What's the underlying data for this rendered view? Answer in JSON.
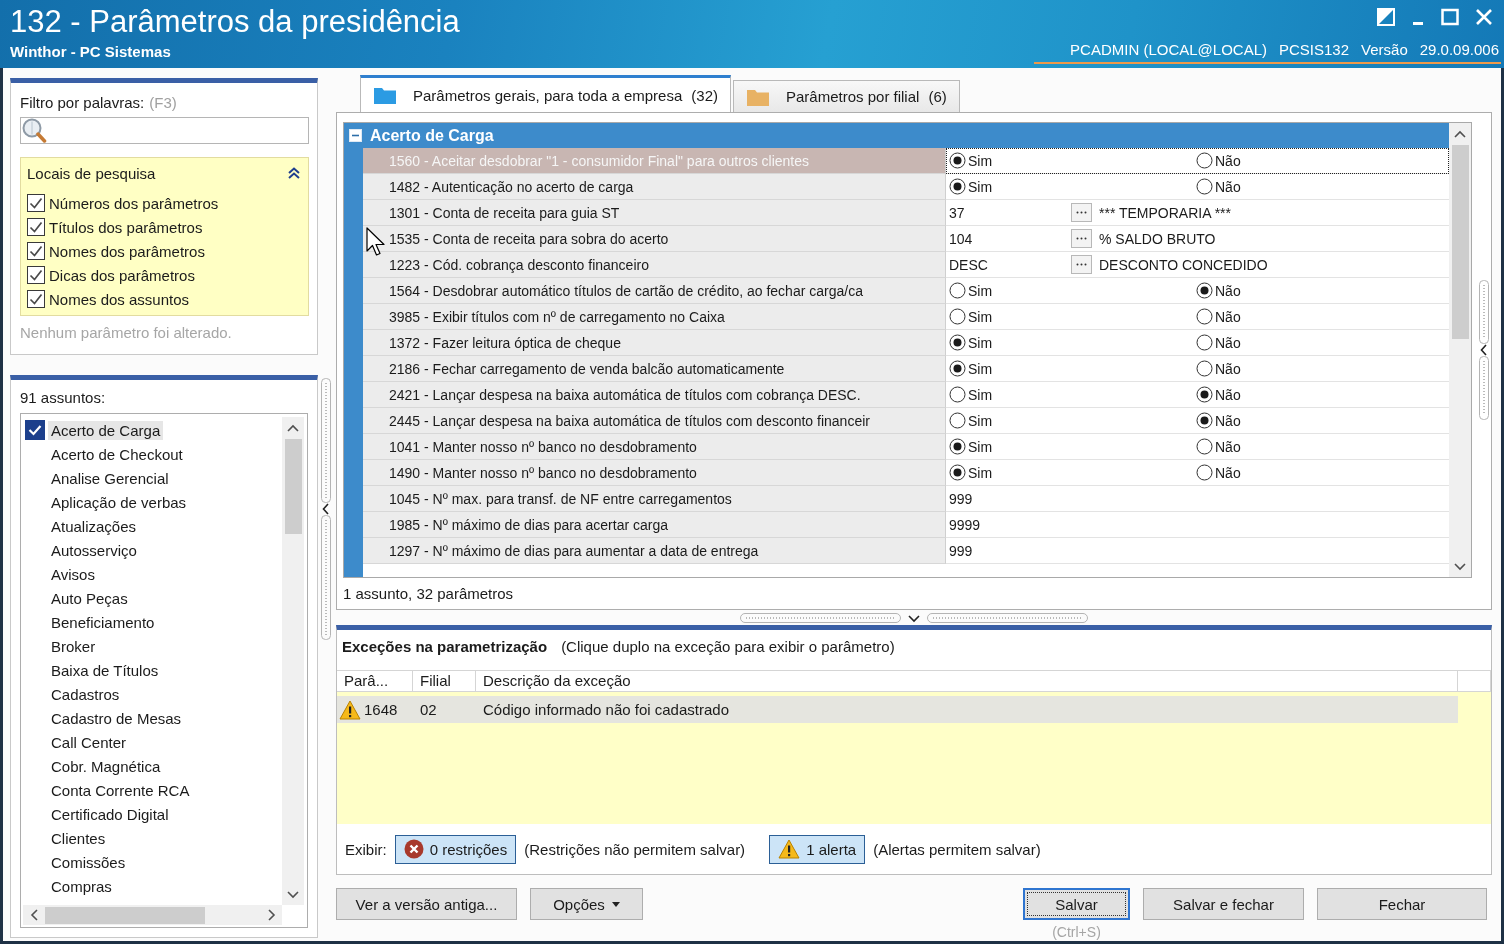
{
  "window": {
    "title": "132 - Parâmetros da presidência",
    "subtitle": "Winthor - PC Sistemas",
    "session": [
      "PCADMIN (LOCAL@LOCAL)",
      "PCSIS132",
      "Versão",
      "29.0.09.006"
    ]
  },
  "filter": {
    "label": "Filtro por palavras:",
    "shortcut": "(F3)",
    "search_places": {
      "title": "Locais de pesquisa",
      "expanded": true,
      "options": [
        {
          "label": "Números dos parâmetros",
          "checked": true
        },
        {
          "label": "Títulos dos parâmetros",
          "checked": true
        },
        {
          "label": "Nomes dos parâmetros",
          "checked": true
        },
        {
          "label": "Dicas dos parâmetros",
          "checked": true
        },
        {
          "label": "Nomes dos assuntos",
          "checked": true
        }
      ]
    },
    "status": "Nenhum parâmetro foi alterado."
  },
  "subjects": {
    "count_label": "91 assuntos:",
    "items": [
      {
        "label": "Acerto de Carga",
        "checked": true,
        "selected": true
      },
      {
        "label": "Acerto de Checkout",
        "checked": false,
        "selected": false
      },
      {
        "label": "Analise Gerencial",
        "checked": false,
        "selected": false
      },
      {
        "label": "Aplicação de verbas",
        "checked": false,
        "selected": false
      },
      {
        "label": "Atualizações",
        "checked": false,
        "selected": false
      },
      {
        "label": "Autosserviço",
        "checked": false,
        "selected": false
      },
      {
        "label": "Avisos",
        "checked": false,
        "selected": false
      },
      {
        "label": "Auto Peças",
        "checked": false,
        "selected": false
      },
      {
        "label": "Beneficiamento",
        "checked": false,
        "selected": false
      },
      {
        "label": "Broker",
        "checked": false,
        "selected": false
      },
      {
        "label": "Baixa de Títulos",
        "checked": false,
        "selected": false
      },
      {
        "label": "Cadastros",
        "checked": false,
        "selected": false
      },
      {
        "label": "Cadastro de Mesas",
        "checked": false,
        "selected": false
      },
      {
        "label": "Call Center",
        "checked": false,
        "selected": false
      },
      {
        "label": "Cobr. Magnética",
        "checked": false,
        "selected": false
      },
      {
        "label": "Conta Corrente RCA",
        "checked": false,
        "selected": false
      },
      {
        "label": "Certificado Digital",
        "checked": false,
        "selected": false
      },
      {
        "label": "Clientes",
        "checked": false,
        "selected": false
      },
      {
        "label": "Comissões",
        "checked": false,
        "selected": false
      },
      {
        "label": "Compras",
        "checked": false,
        "selected": false
      }
    ]
  },
  "tabs": [
    {
      "label": "Parâmetros gerais, para toda a empresa",
      "count": "(32)",
      "selected": true,
      "color": "#2b9be3"
    },
    {
      "label": "Parâmetros por filial",
      "count": "(6)",
      "selected": false,
      "color": "#e8b264"
    }
  ],
  "parameter_grid": {
    "groups": [
      {
        "title": "Acerto de Carga",
        "expanded": true,
        "rows": [
          {
            "kind": "radio",
            "label": "1560 - Aceitar desdobrar \"1 - consumidor Final\" para outros clientes",
            "selected": true,
            "options": [
              {
                "label": "Sim",
                "selected": true
              },
              {
                "label": "Não",
                "selected": false
              }
            ]
          },
          {
            "kind": "radio",
            "label": "1482 - Autenticação no acerto de carga",
            "selected": false,
            "options": [
              {
                "label": "Sim",
                "selected": true
              },
              {
                "label": "Não",
                "selected": false
              }
            ]
          },
          {
            "kind": "lookup",
            "label": "1301 - Conta de receita para guia ST",
            "selected": false,
            "code": "37",
            "description": "*** TEMPORARIA ***"
          },
          {
            "kind": "lookup",
            "label": "1535 - Conta de receita para sobra do acerto",
            "selected": false,
            "code": "104",
            "description": "% SALDO BRUTO"
          },
          {
            "kind": "lookup",
            "label": "1223 - Cód. cobrança desconto financeiro",
            "selected": false,
            "code": "DESC",
            "description": "DESCONTO CONCEDIDO"
          },
          {
            "kind": "radio",
            "label": "1564 - Desdobrar automático títulos de cartão de crédito, ao fechar carga/ca",
            "selected": false,
            "options": [
              {
                "label": "Sim",
                "selected": false
              },
              {
                "label": "Não",
                "selected": true
              }
            ]
          },
          {
            "kind": "radio",
            "label": "3985 - Exibir títulos com nº de carregamento no Caixa",
            "selected": false,
            "options": [
              {
                "label": "Sim",
                "selected": false
              },
              {
                "label": "Não",
                "selected": false
              }
            ]
          },
          {
            "kind": "radio",
            "label": "1372 - Fazer leitura óptica de cheque",
            "selected": false,
            "options": [
              {
                "label": "Sim",
                "selected": true
              },
              {
                "label": "Não",
                "selected": false
              }
            ]
          },
          {
            "kind": "radio",
            "label": "2186 - Fechar carregamento de venda balcão automaticamente",
            "selected": false,
            "options": [
              {
                "label": "Sim",
                "selected": true
              },
              {
                "label": "Não",
                "selected": false
              }
            ]
          },
          {
            "kind": "radio",
            "label": "2421 - Lançar despesa na baixa automática de títulos com cobrança DESC.",
            "selected": false,
            "options": [
              {
                "label": "Sim",
                "selected": false
              },
              {
                "label": "Não",
                "selected": true
              }
            ]
          },
          {
            "kind": "radio",
            "label": "2445 - Lançar despesa na baixa automática de títulos com desconto financeir",
            "selected": false,
            "options": [
              {
                "label": "Sim",
                "selected": false
              },
              {
                "label": "Não",
                "selected": true
              }
            ]
          },
          {
            "kind": "radio",
            "label": "1041 - Manter nosso nº banco no desdobramento",
            "selected": false,
            "options": [
              {
                "label": "Sim",
                "selected": true
              },
              {
                "label": "Não",
                "selected": false
              }
            ]
          },
          {
            "kind": "radio",
            "label": "1490 - Manter nosso nº banco no desdobramento",
            "selected": false,
            "options": [
              {
                "label": "Sim",
                "selected": true
              },
              {
                "label": "Não",
                "selected": false
              }
            ]
          },
          {
            "kind": "text",
            "label": "1045 - Nº max. para transf. de NF entre carregamentos",
            "selected": false,
            "value": "999"
          },
          {
            "kind": "text",
            "label": "1985 - Nº máximo de dias para acertar carga",
            "selected": false,
            "value": "9999"
          },
          {
            "kind": "text",
            "label": "1297 - Nº máximo de dias para aumentar a data de entrega",
            "selected": false,
            "value": "999"
          }
        ]
      }
    ],
    "status": "1 assunto, 32 parâmetros"
  },
  "exceptions": {
    "title": "Exceções na parametrização",
    "hint": "(Clique duplo na exceção para exibir o parâmetro)",
    "columns": [
      "Parâ...",
      "Filial",
      "Descrição da exceção"
    ],
    "rows": [
      {
        "kind": "alert",
        "selected": true,
        "cells": [
          "1648",
          "02",
          "Código informado não foi cadastrado"
        ]
      }
    ],
    "filter_label": "Exibir:",
    "filters": [
      {
        "kind": "restriction",
        "label": "0 restrições",
        "note": "(Restrições não permitem salvar)",
        "on": true
      },
      {
        "kind": "alert",
        "label": "1 alerta",
        "note": "(Alertas permitem salvar)",
        "on": true
      }
    ]
  },
  "actions": {
    "left": [
      {
        "kind": "plain",
        "label": "Ver a versão antiga...",
        "focused": false
      },
      {
        "kind": "menu",
        "label": "Opções",
        "focused": false
      }
    ],
    "right": [
      {
        "kind": "plain",
        "label": "Salvar",
        "focused": true,
        "shortcut": "(Ctrl+S)"
      },
      {
        "kind": "plain",
        "label": "Salvar e fechar",
        "focused": false
      },
      {
        "kind": "plain",
        "label": "Fechar",
        "focused": false
      }
    ]
  }
}
